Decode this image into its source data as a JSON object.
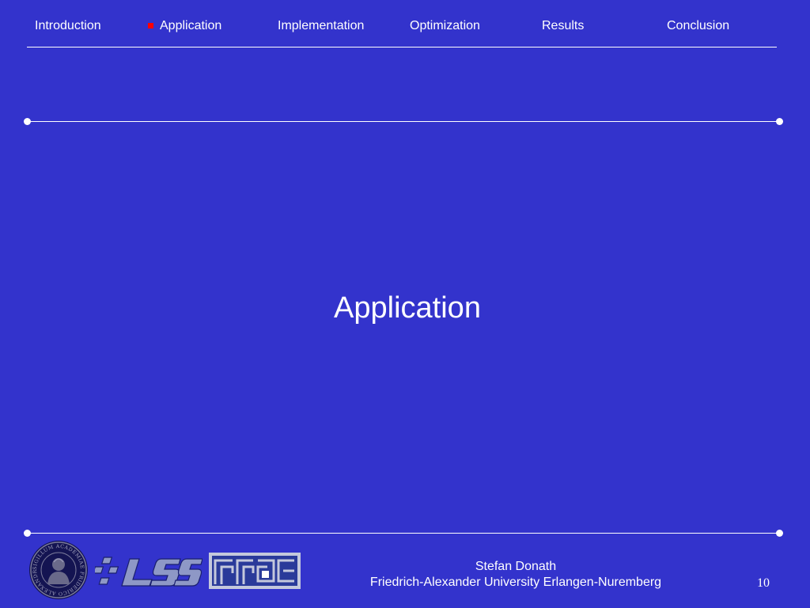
{
  "nav": {
    "items": [
      {
        "label": "Introduction",
        "active": false
      },
      {
        "label": "Application",
        "active": true
      },
      {
        "label": "Implementation",
        "active": false
      },
      {
        "label": "Optimization",
        "active": false
      },
      {
        "label": "Results",
        "active": false
      },
      {
        "label": "Conclusion",
        "active": false
      }
    ],
    "active_marker_color": "#ff0000"
  },
  "slide": {
    "section_title": "Application",
    "background_color": "#3333cc"
  },
  "footer": {
    "author": "Stefan Donath",
    "affiliation": "Friedrich-Alexander University Erlangen-Nuremberg",
    "page_number": "10",
    "seal_text": "SIGILLUM ACADEMIAE FRIDERICO ALEXANDRINAE",
    "logos": [
      "university-seal-logo",
      "lss-logo",
      "rrze-logo"
    ]
  }
}
